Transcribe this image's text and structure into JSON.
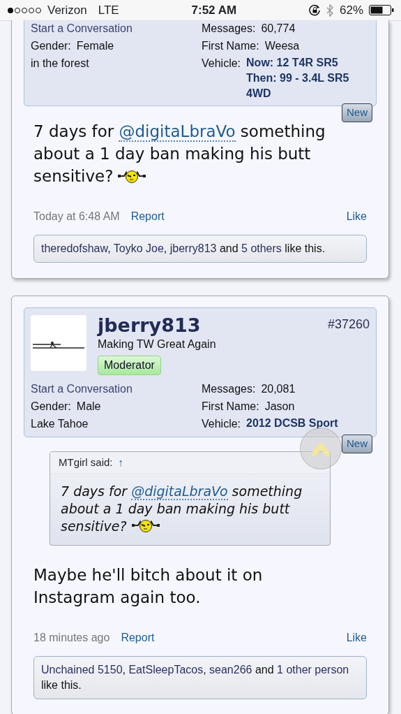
{
  "status_bar": {
    "carrier": "Verizon",
    "network": "LTE",
    "time": "7:52 AM",
    "battery": "62%"
  },
  "posts": [
    {
      "info": {
        "conversation": "Start a Conversation",
        "left": [
          {
            "label": "Gender:",
            "value": "Female"
          },
          {
            "value": "in the forest"
          }
        ],
        "right": [
          {
            "label": "Messages:",
            "value": "60,774",
            "kind": "plain"
          },
          {
            "label": "First Name:",
            "value": "Weesa",
            "kind": "plain"
          },
          {
            "label": "Vehicle:",
            "lines": [
              "Now: 12 T4R SR5",
              "Then: 99 - 3.4L SR5 4WD"
            ],
            "kind": "vehicle"
          }
        ]
      },
      "new_badge": "New",
      "message": {
        "before": "7 days for ",
        "mention": "@digitaLbraVo",
        "after": " something about a 1 day ban making his butt sensitive?",
        "smiley": true
      },
      "time": "Today at 6:48 AM",
      "report": "Report",
      "like": "Like",
      "likes": {
        "names": [
          "theredofshaw",
          "Toyko Joe",
          "jberry813"
        ],
        "separator": ", ",
        "and": "and",
        "others": "5 others",
        "suffix": "like this."
      }
    },
    {
      "author": {
        "name": "jberry813",
        "title": "Making TW Great Again",
        "badge": "Moderator"
      },
      "number": "#37260",
      "info": {
        "conversation": "Start a Conversation",
        "left": [
          {
            "label": "Gender:",
            "value": "Male"
          },
          {
            "value": "Lake Tahoe"
          }
        ],
        "right": [
          {
            "label": "Messages:",
            "value": "20,081",
            "kind": "plain"
          },
          {
            "label": "First Name:",
            "value": "Jason",
            "kind": "plain"
          },
          {
            "label": "Vehicle:",
            "lines": [
              "2012 DCSB Sport"
            ],
            "kind": "vehicle"
          }
        ]
      },
      "new_badge": "New",
      "quote": {
        "author": "MTgirl said:",
        "jump": "↑",
        "message": {
          "before": "7 days for ",
          "mention": "@digitaLbraVo",
          "after": " something about a 1 day ban making his butt sensitive?",
          "smiley": true
        }
      },
      "message": {
        "before": "Maybe he'll bitch about it on Instagram again too.",
        "smiley": false
      },
      "time": "18 minutes ago",
      "report": "Report",
      "like": "Like",
      "likes": {
        "names": [
          "Unchained 5150",
          "EatSleepTacos",
          "sean266"
        ],
        "separator": ", ",
        "and": "and",
        "others": "1 other person",
        "suffix": "like this."
      }
    }
  ]
}
